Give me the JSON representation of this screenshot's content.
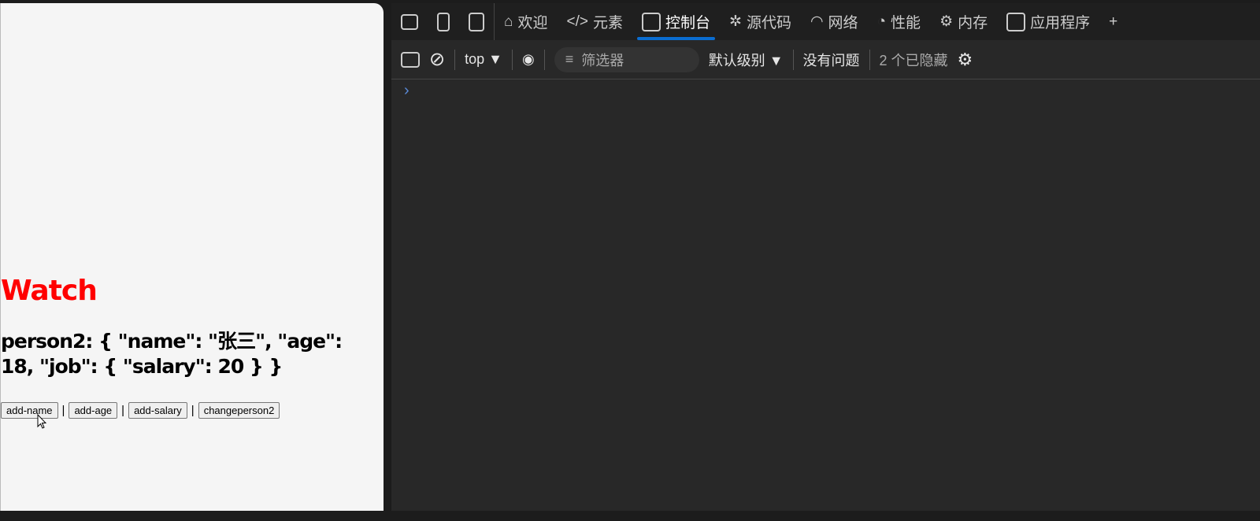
{
  "page": {
    "title": "Watch",
    "json_text": "person2: { \"name\": \"张三\", \"age\": 18, \"job\": { \"salary\": 20 } }",
    "buttons": [
      "add-name",
      "add-age",
      "add-salary",
      "changeperson2"
    ],
    "separator": "|"
  },
  "devtools": {
    "tabs": [
      "欢迎",
      "元素",
      "控制台",
      "源代码",
      "网络",
      "性能",
      "内存",
      "应用程序"
    ],
    "active_tab": "控制台",
    "toolbar": {
      "context": "top",
      "filter_placeholder": "筛选器",
      "level": "默认级别",
      "issues": "没有问题",
      "hidden": "2 个已隐藏"
    },
    "prompt": "›"
  },
  "colors": {
    "accent": "#0a6dd1",
    "title": "#ff0000"
  }
}
